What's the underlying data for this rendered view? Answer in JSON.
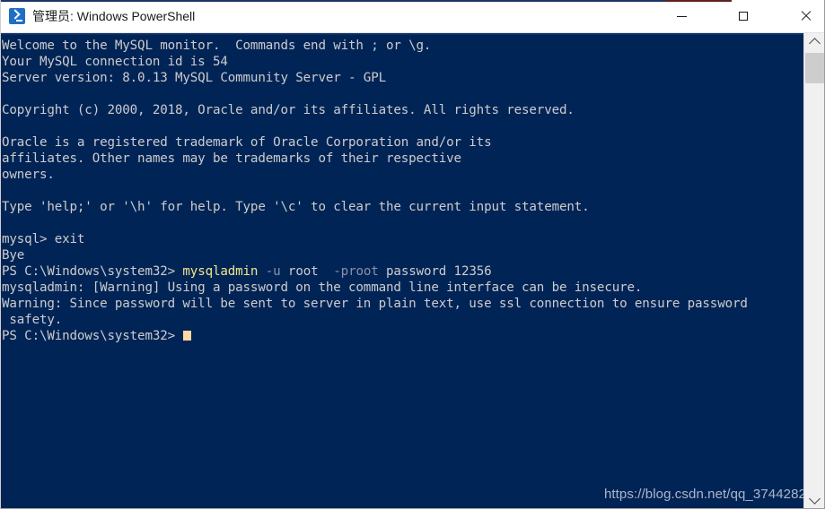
{
  "window": {
    "title": "管理员: Windows PowerShell",
    "icon": "powershell-icon",
    "controls": {
      "minimize": "—",
      "maximize": "□",
      "close": "✕"
    }
  },
  "console": {
    "background_color": "#012456",
    "foreground_color": "#cccccc",
    "accent_command_color": "#f0e68c",
    "dim_arg_color": "#8a93a8",
    "cursor_color": "#ffd9a0",
    "lines": [
      {
        "segments": [
          {
            "text": "Welcome to the MySQL monitor.  Commands end with ; or \\g.",
            "style": "white"
          }
        ]
      },
      {
        "segments": [
          {
            "text": "Your MySQL connection id is 54",
            "style": "white"
          }
        ]
      },
      {
        "segments": [
          {
            "text": "Server version: 8.0.13 MySQL Community Server - GPL",
            "style": "white"
          }
        ]
      },
      {
        "segments": [
          {
            "text": "",
            "style": "white"
          }
        ]
      },
      {
        "segments": [
          {
            "text": "Copyright (c) 2000, 2018, Oracle and/or its affiliates. All rights reserved.",
            "style": "white"
          }
        ]
      },
      {
        "segments": [
          {
            "text": "",
            "style": "white"
          }
        ]
      },
      {
        "segments": [
          {
            "text": "Oracle is a registered trademark of Oracle Corporation and/or its",
            "style": "white"
          }
        ]
      },
      {
        "segments": [
          {
            "text": "affiliates. Other names may be trademarks of their respective",
            "style": "white"
          }
        ]
      },
      {
        "segments": [
          {
            "text": "owners.",
            "style": "white"
          }
        ]
      },
      {
        "segments": [
          {
            "text": "",
            "style": "white"
          }
        ]
      },
      {
        "segments": [
          {
            "text": "Type 'help;' or '\\h' for help. Type '\\c' to clear the current input statement.",
            "style": "white"
          }
        ]
      },
      {
        "segments": [
          {
            "text": "",
            "style": "white"
          }
        ]
      },
      {
        "segments": [
          {
            "text": "mysql> exit",
            "style": "white"
          }
        ]
      },
      {
        "segments": [
          {
            "text": "Bye",
            "style": "white"
          }
        ]
      },
      {
        "segments": [
          {
            "text": "PS C:\\Windows\\system32> ",
            "style": "white"
          },
          {
            "text": "mysqladmin",
            "style": "yellow"
          },
          {
            "text": " ",
            "style": "white"
          },
          {
            "text": "-u",
            "style": "dim"
          },
          {
            "text": " root  ",
            "style": "white"
          },
          {
            "text": "-proot",
            "style": "dim"
          },
          {
            "text": " password 12356",
            "style": "white"
          }
        ]
      },
      {
        "segments": [
          {
            "text": "mysqladmin: [Warning] Using a password on the command line interface can be insecure.",
            "style": "white"
          }
        ]
      },
      {
        "segments": [
          {
            "text": "Warning: Since password will be sent to server in plain text, use ssl connection to ensure password",
            "style": "white"
          }
        ]
      },
      {
        "segments": [
          {
            "text": " safety.",
            "style": "white"
          }
        ]
      },
      {
        "segments": [
          {
            "text": "PS C:\\Windows\\system32>",
            "style": "white"
          },
          {
            "text": "",
            "style": "cursor"
          }
        ]
      }
    ]
  },
  "watermark": {
    "text": "https://blog.csdn.net/qq_3744282"
  },
  "scrollbar": {
    "up_arrow": "scroll-up",
    "down_arrow": "scroll-down",
    "thumb": "scroll-thumb"
  }
}
